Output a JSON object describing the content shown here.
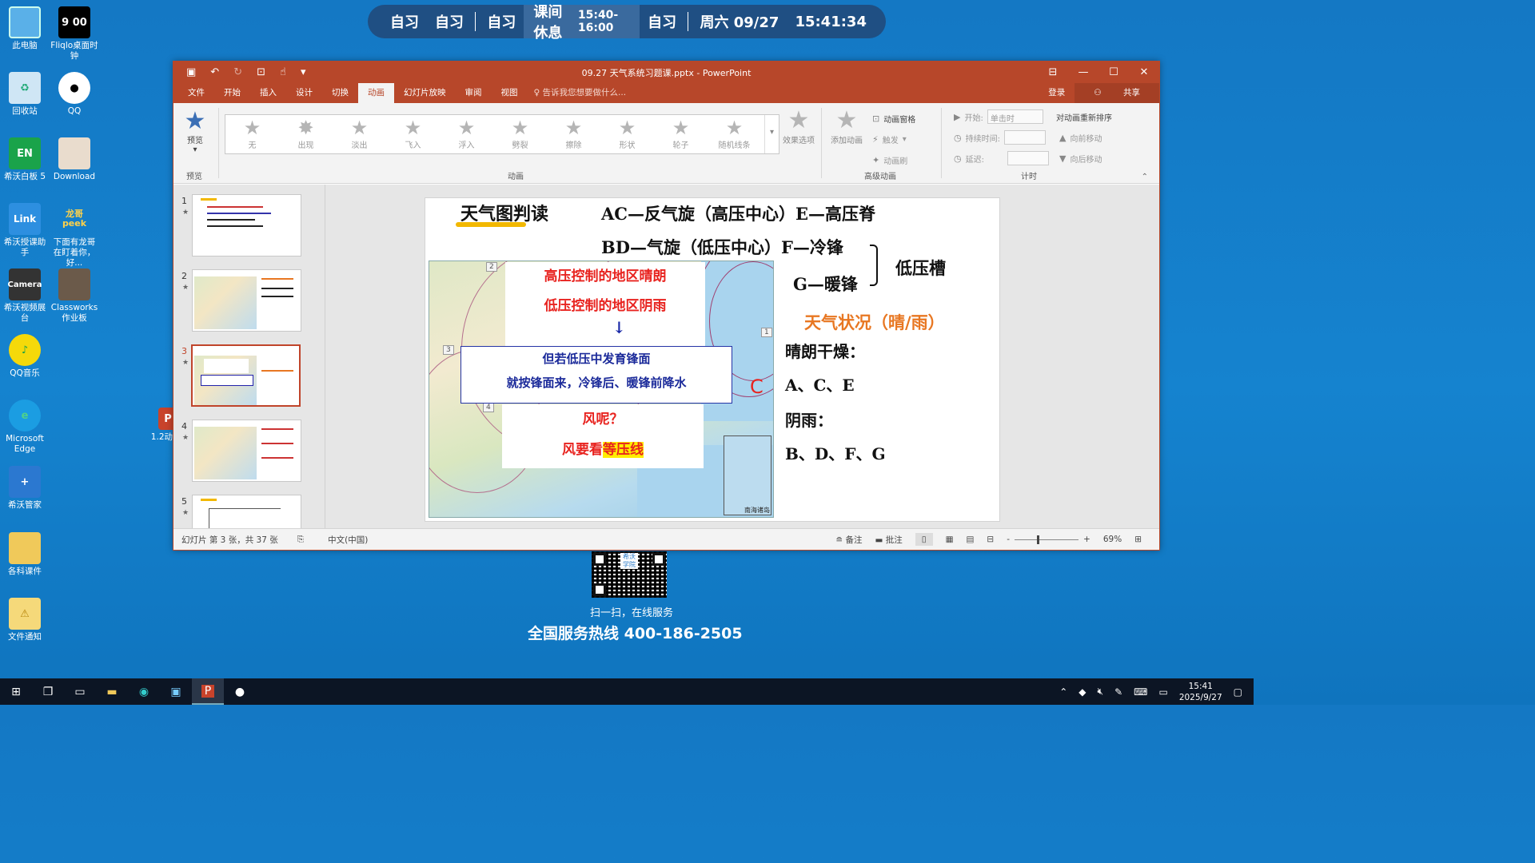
{
  "schedule": {
    "items": [
      "自习",
      "自习",
      "自习"
    ],
    "current_label": "课间休息",
    "current_time": "15:40-16:00",
    "after": "自习",
    "date": "周六 09/27",
    "clock": "15:41:34"
  },
  "desktop_icons": [
    {
      "label": "此电脑",
      "icon": "computer-icon"
    },
    {
      "label": "Fliqlo桌面时钟",
      "icon": "clock-app-icon",
      "glyph": "9 00"
    },
    {
      "label": "回收站",
      "icon": "recycle-bin-icon"
    },
    {
      "label": "QQ",
      "icon": "qq-icon"
    },
    {
      "label": "希沃白板 5",
      "icon": "whiteboard-icon",
      "glyph": "EN"
    },
    {
      "label": "Download",
      "icon": "download-folder-icon"
    },
    {
      "label": "希沃授课助手",
      "icon": "link-app-icon",
      "glyph": "Link"
    },
    {
      "label": "下面有龙哥在盯着你，好...",
      "icon": "peek-app-icon",
      "glyph": "龙哥 peek"
    },
    {
      "label": "希沃视频展台",
      "icon": "camera-app-icon",
      "glyph": "Camera"
    },
    {
      "label": "Classworks 作业板",
      "icon": "classworks-icon"
    },
    {
      "label": "QQ音乐",
      "icon": "qq-music-icon"
    },
    {
      "label": "Microsoft Edge",
      "icon": "edge-icon"
    },
    {
      "label": "希沃管家",
      "icon": "seewo-manager-icon"
    },
    {
      "label": "各科课件",
      "icon": "folder-icon"
    },
    {
      "label": "文件通知",
      "icon": "warning-file-icon"
    },
    {
      "label": "1.2动",
      "icon": "pptx-file-icon"
    }
  ],
  "window": {
    "title": "09.27 天气系统习题课.pptx - PowerPoint",
    "tabs": [
      "文件",
      "开始",
      "插入",
      "设计",
      "切换",
      "动画",
      "幻灯片放映",
      "审阅",
      "视图"
    ],
    "active_tab": "动画",
    "tell_me": "告诉我您想要做什么...",
    "login": "登录",
    "share": "共享",
    "accent": "#b7472a"
  },
  "ribbon": {
    "preview_label": "预览",
    "preview_group": "预览",
    "animations": [
      "无",
      "出现",
      "淡出",
      "飞入",
      "浮入",
      "劈裂",
      "擦除",
      "形状",
      "轮子",
      "随机线条"
    ],
    "animation_group": "动画",
    "effect_options": "效果选项",
    "add_animation": "添加动画",
    "animation_pane": "动画窗格",
    "trigger": "触发",
    "animation_painter": "动画刷",
    "advanced_group": "高级动画",
    "start_label": "开始:",
    "start_value": "单击时",
    "duration_label": "持续时间:",
    "delay_label": "延迟:",
    "reorder_label": "对动画重新排序",
    "move_earlier": "向前移动",
    "move_later": "向后移动",
    "timing_group": "计时"
  },
  "thumbnails": [
    {
      "num": "1",
      "selected": false
    },
    {
      "num": "2",
      "selected": false
    },
    {
      "num": "3",
      "selected": true
    },
    {
      "num": "4",
      "selected": false
    },
    {
      "num": "5",
      "selected": false
    }
  ],
  "slide": {
    "title": "天气图判读",
    "line1": "AC—反气旋（高压中心）E—高压脊",
    "line2": "BD—气旋（低压中心）F—冷锋",
    "line3": "G—暖锋",
    "trough": "低压槽",
    "note1a": "高压控制的地区晴朗",
    "note1b": "低压控制的地区阴雨",
    "note2a": "但若低压中发育锋面",
    "note2b": "就按锋面来，冷锋后、暖锋前降水",
    "note3a": "风呢？",
    "note3b_pre": "风要看",
    "note3b_hl": "等压线",
    "weather": "天气状况（晴/雨）",
    "sunny": "晴朗干燥：",
    "sunny_list": "A、C、E",
    "rainy": "阴雨：",
    "rainy_list": "B、D、F、G",
    "marker_c": "C",
    "inset_label": "南海诸岛",
    "markers": [
      "2",
      "3",
      "3",
      "4",
      "1"
    ]
  },
  "status": {
    "slide_info": "幻灯片 第 3 张，共 37 张",
    "language": "中文(中国)",
    "notes": "备注",
    "comments": "批注",
    "zoom": "69%",
    "zoom_minus": "-",
    "zoom_plus": "+"
  },
  "service": {
    "scan": "扫一扫，在线服务",
    "hotline": "全国服务热线 400-186-2505",
    "qr_logo": "希沃学院"
  },
  "taskbar": {
    "time": "15:41",
    "date": "2025/9/27"
  }
}
